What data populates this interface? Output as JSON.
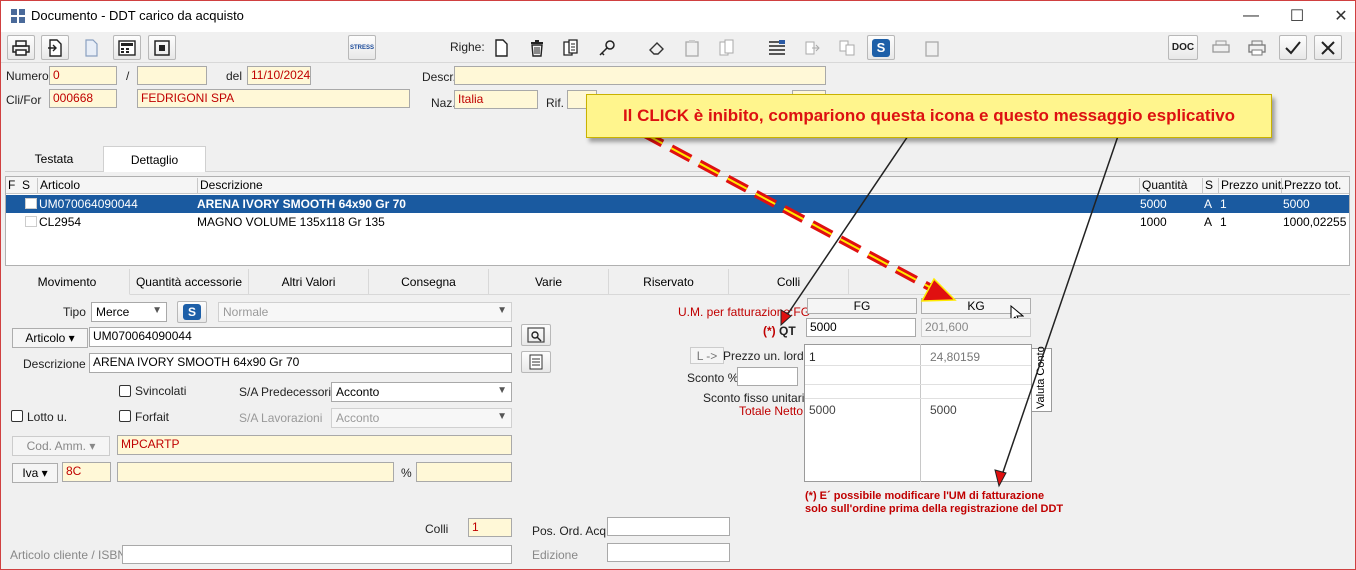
{
  "window": {
    "title": "Documento - DDT carico da acquisto",
    "minimize": "—",
    "maximize": "☐",
    "close": "✕"
  },
  "toolbar": {
    "stress_label": "STRESS",
    "righe_label": "Righe:",
    "s_button_label": "S",
    "doc_label": "DOC"
  },
  "header": {
    "numero_label": "Numero",
    "numero_value": "0",
    "slash": "/",
    "suffix_value": "",
    "del_label": "del",
    "date_value": "11/10/2024",
    "descr_label": "Descr.",
    "descr_value": "",
    "clifor_label": "Cli/For",
    "clifor_code": "000668",
    "clifor_name": "FEDRIGONI SPA",
    "naz_label": "Naz.",
    "naz_value": "Italia",
    "rif_label": "Rif."
  },
  "main_tabs": [
    "Testata",
    "Dettaglio"
  ],
  "grid": {
    "columns": [
      "F",
      "S",
      "Articolo",
      "Descrizione",
      "Quantità",
      "S",
      "Prezzo unit.",
      "Prezzo tot."
    ],
    "rows": [
      {
        "articolo": "UM070064090044",
        "descrizione": "ARENA IVORY SMOOTH 64x90 Gr 70",
        "quantita": "5000",
        "s": "A",
        "prezzo_unit": "1",
        "prezzo_tot": "5000"
      },
      {
        "articolo": "CL2954",
        "descrizione": "MAGNO VOLUME 135x118 Gr 135",
        "quantita": "1000",
        "s": "A",
        "prezzo_unit": "1",
        "prezzo_tot": "1000,02255"
      }
    ]
  },
  "bottom_tabs": [
    "Movimento",
    "Quantità accessorie",
    "Altri Valori",
    "Consegna",
    "Varie",
    "Riservato",
    "Colli"
  ],
  "movimento": {
    "tipo_label": "Tipo",
    "tipo_value": "Merce",
    "s_label": "S",
    "normale_value": "Normale",
    "articolo_btn": "Articolo ▾",
    "articolo_value": "UM070064090044",
    "descrizione_label": "Descrizione",
    "descrizione_value": "ARENA IVORY SMOOTH 64x90 Gr 70",
    "svincolati_label": "Svincolati",
    "sa_pred_label": "S/A Predecessori",
    "sa_pred_value": "Acconto",
    "lotto_label": "Lotto u.",
    "forfait_label": "Forfait",
    "sa_lav_label": "S/A  Lavorazioni",
    "sa_lav_value": "Acconto",
    "cod_amm_btn": "Cod. Amm. ▾",
    "cod_amm_value": "MPCARTP",
    "iva_btn": "Iva ▾",
    "iva_value": "8C",
    "iva_desc": "",
    "perc_label": "%",
    "perc_value": "",
    "colli_label": "Colli",
    "colli_value": "1",
    "pos_ord_label": "Pos. Ord. Acq.",
    "pos_ord_value": "",
    "articolo_cliente_label": "Articolo cliente / ISBN",
    "edizione_label": "Edizione"
  },
  "pricing": {
    "um_label": "U.M. per fatturazione:FG",
    "col_fg": "FG",
    "col_kg": "KG",
    "qt_label_mark": "(*)",
    "qt_label": "QT",
    "qt_fg": "5000",
    "qt_kg": "201,600",
    "arrow_btn": "L ->",
    "prezzo_label": "Prezzo un. lordo",
    "prezzo_fg": "1",
    "prezzo_kg": "24,80159",
    "sconto_label": "Sconto %",
    "sconto_fisso_label": "Sconto fisso unitario",
    "totale_label": "Totale Netto",
    "totale_fg": "5000",
    "totale_kg": "5000",
    "side_tab": "Valuta Conto"
  },
  "annotations": {
    "callout": "Il CLICK è inibito, compariono questa icona e questo messaggio esplicativo",
    "note": "(*) E´ possibile modificare l'UM di fatturazione solo sull'ordine prima della registrazione del DDT"
  }
}
